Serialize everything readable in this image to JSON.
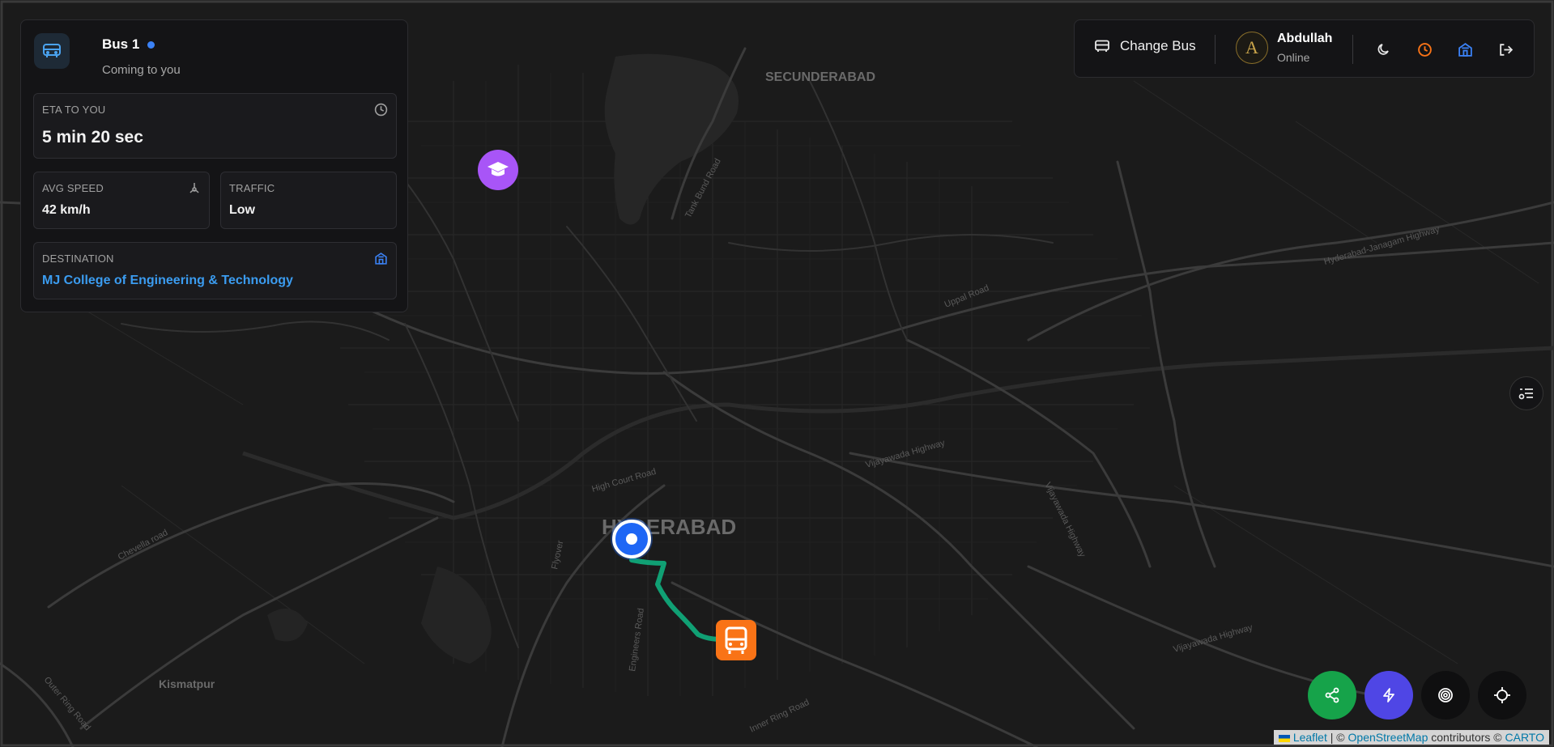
{
  "map": {
    "labels": {
      "secunderabad": "SECUNDERABAD",
      "hyderabad": "HYDERABAD",
      "kismatpur": "Kismatpur"
    },
    "roads": {
      "tank_bund": "Tank Bund Road",
      "uppal": "Uppal Road",
      "hyd_jangaon": "Hyderabad-Janagam Highway",
      "high_court": "High Court Road",
      "vijayawada1": "Vijayawada Highway",
      "vijayawada2": "Vijayawada Highway",
      "vijayawada3": "Vijayawada Highway",
      "chevella": "Chevella road",
      "inner_ring": "Inner Ring Road",
      "outer_ring": "Outer Ring Road",
      "engineers": "Engineers Road",
      "flyover": "Flyover"
    },
    "colors": {
      "background": "#1b1b1b",
      "route": "#10a074",
      "user_marker": "#1e66f5",
      "bus_marker": "#f97316",
      "college_marker": "#a855f7"
    }
  },
  "card": {
    "bus_name": "Bus 1",
    "bus_status": "Coming to you",
    "eta": {
      "label": "ETA TO YOU",
      "value": "5 min 20 sec"
    },
    "speed": {
      "label": "AVG SPEED",
      "value": "42 km/h"
    },
    "traffic": {
      "label": "TRAFFIC",
      "value": "Low"
    },
    "destination": {
      "label": "DESTINATION",
      "value": "MJ College of Engineering & Technology"
    }
  },
  "toolbar": {
    "change_bus": "Change Bus",
    "avatar_letter": "A",
    "user_name": "Abdullah",
    "user_status": "Online",
    "icons": [
      "moon-icon",
      "clock-icon",
      "building-icon",
      "logout-icon"
    ],
    "accent_clock": "#f97316",
    "accent_building": "#3b82f6"
  },
  "fabs": {
    "share_color": "#16a34a",
    "flash_color": "#4f46e5",
    "target_color": "#0f0f10",
    "locate_color": "#0f0f10"
  },
  "attribution": {
    "leaflet": "Leaflet",
    "sep": "|",
    "copy1": "©",
    "osm": "OpenStreetMap",
    "contributors": "contributors ©",
    "carto": "CARTO"
  }
}
